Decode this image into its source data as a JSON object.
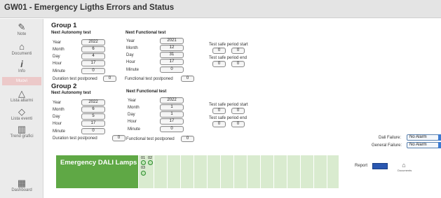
{
  "window": {
    "title": "GW01 - Emergency Ligths Errors and Status"
  },
  "sidebar": {
    "items": [
      {
        "label": "Note",
        "icon": "pencil-icon"
      },
      {
        "label": "Documenti",
        "icon": "inbox-icon"
      },
      {
        "label": "Info",
        "icon": "info-icon"
      },
      {
        "label": "Muovi",
        "icon": "move-icon",
        "disabled": true
      },
      {
        "label": "Lista allarmi",
        "icon": "bell-icon"
      },
      {
        "label": "Lista eventi",
        "icon": "eraser-icon"
      },
      {
        "label": "Trend grafici",
        "icon": "chart-icon"
      },
      {
        "label": "Dashboard",
        "icon": "dashboard-icon"
      }
    ]
  },
  "labels": {
    "year": "Year",
    "month": "Month",
    "day": "Day",
    "hour": "Hour",
    "minute": "Minute",
    "next_autonomy": "Next Autonomy test",
    "next_functional": "Next Functional test",
    "duration_postponed": "Duration test postponed",
    "functional_postponed": "Functional test postponed",
    "safe_start": "Test safe period start",
    "safe_end": "Test safe period end"
  },
  "group1": {
    "title": "Group 1",
    "autonomy": {
      "year": "2022",
      "month": "6",
      "day": "4",
      "hour": "17",
      "minute": "0"
    },
    "functional": {
      "year": "2021",
      "month": "12",
      "day": "31",
      "hour": "17",
      "minute": "0"
    },
    "duration_postponed": "0",
    "functional_postponed": "0",
    "safe_start": [
      "0",
      "0"
    ],
    "safe_end": [
      "0",
      "0"
    ]
  },
  "group2": {
    "title": "Group 2",
    "autonomy": {
      "year": "2022",
      "month": "6",
      "day": "5",
      "hour": "17",
      "minute": "0"
    },
    "functional": {
      "year": "2022",
      "month": "1",
      "day": "1",
      "hour": "17",
      "minute": "0"
    },
    "duration_postponed": "0",
    "functional_postponed": "0",
    "safe_start": [
      "0",
      "0"
    ],
    "safe_end": [
      "0",
      "0"
    ]
  },
  "status": {
    "dali_failure_label": "Dali Failure:",
    "dali_failure_value": "No Alarm",
    "general_failure_label": "General Failure:",
    "general_failure_value": "No Alarm"
  },
  "lamps": {
    "title": "Emergency DALI Lamps",
    "items": [
      {
        "num": "01"
      },
      {
        "num": "02"
      },
      {
        "num": "03"
      }
    ]
  },
  "report": {
    "label": "Report",
    "doc_label": "Documents"
  },
  "colors": {
    "lamp_header": "#5fa845",
    "lamp_panel": "#d9ebcf",
    "report_button": "#2a57b0",
    "alarm_tab": "#3b7ad1"
  }
}
